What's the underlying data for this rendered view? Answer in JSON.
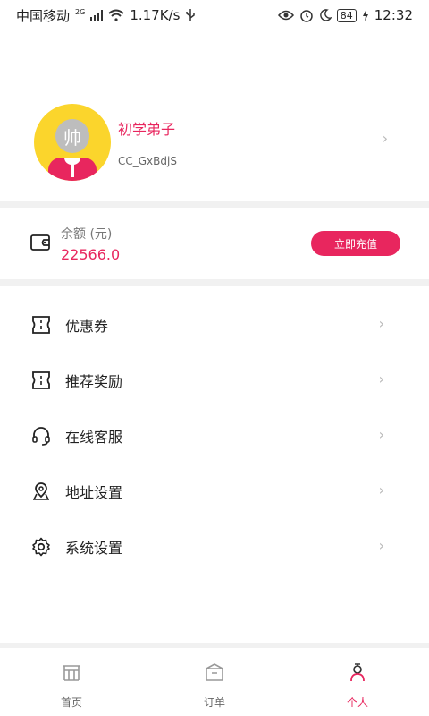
{
  "status_bar": {
    "carrier": "中国移动",
    "network": "2G",
    "speed": "1.17K/s",
    "battery": "84",
    "time": "12:32"
  },
  "profile": {
    "avatar_text": "帅",
    "nickname": "初学弟子",
    "username": "CC_GxBdjS"
  },
  "balance": {
    "label": "余额 (元)",
    "value": "22566.0",
    "recharge_label": "立即充值"
  },
  "menu": {
    "items": [
      {
        "label": "优惠券",
        "icon": "coupon-icon"
      },
      {
        "label": "推荐奖励",
        "icon": "ticket-icon"
      },
      {
        "label": "在线客服",
        "icon": "headset-icon"
      },
      {
        "label": "地址设置",
        "icon": "location-icon"
      },
      {
        "label": "系统设置",
        "icon": "gear-icon"
      }
    ]
  },
  "tabs": [
    {
      "label": "首页",
      "icon": "home-icon",
      "active": false
    },
    {
      "label": "订单",
      "icon": "order-icon",
      "active": false
    },
    {
      "label": "个人",
      "icon": "person-icon",
      "active": true
    }
  ],
  "colors": {
    "accent": "#e8265e",
    "avatar_bg": "#fbd52c",
    "divider": "#f1f1f1"
  }
}
